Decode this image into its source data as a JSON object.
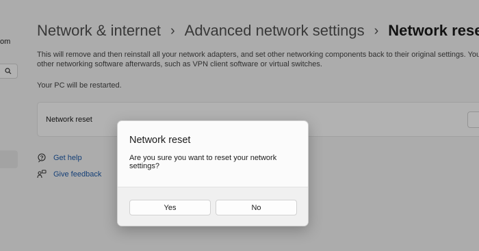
{
  "sidebar": {
    "account_fragment": "om"
  },
  "breadcrumb": {
    "items": [
      "Network & internet",
      "Advanced network settings"
    ],
    "current": "Network reset"
  },
  "description": {
    "line1": "This will remove and then reinstall all your network adapters, and set other networking components back to their original settings. You might n",
    "line2": "other networking software afterwards, such as VPN client software or virtual switches."
  },
  "restart_note": "Your PC will be restarted.",
  "card": {
    "label": "Network reset"
  },
  "links": {
    "help": "Get help",
    "feedback": "Give feedback"
  },
  "dialog": {
    "title": "Network reset",
    "message": "Are you sure you want to reset your network settings?",
    "yes_label": "Yes",
    "no_label": "No"
  }
}
